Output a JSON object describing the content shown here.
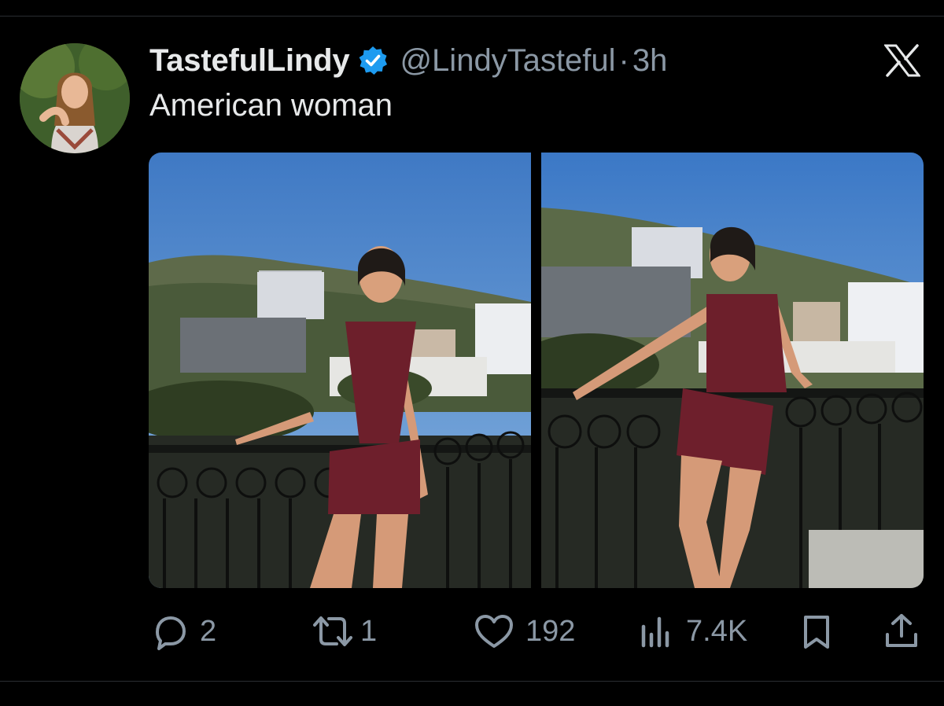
{
  "post": {
    "display_name": "TastefulLindy",
    "handle": "@LindyTasteful",
    "separator": "·",
    "time": "3h",
    "text": "American woman",
    "verified": true
  },
  "icons": {
    "avatar": "profile-avatar",
    "verified": "verified-badge-icon",
    "brand": "x-logo-icon",
    "reply": "reply-icon",
    "repost": "repost-icon",
    "like": "heart-icon",
    "views": "views-icon",
    "bookmark": "bookmark-icon",
    "share": "share-icon"
  },
  "media": {
    "count": 2
  },
  "stats": {
    "replies": "2",
    "reposts": "1",
    "likes": "192",
    "views": "7.4K"
  },
  "colors": {
    "background": "#000000",
    "text": "#e7e9ea",
    "muted": "#8b98a5",
    "verified": "#1d9bf0",
    "divider": "#2a2d31"
  }
}
